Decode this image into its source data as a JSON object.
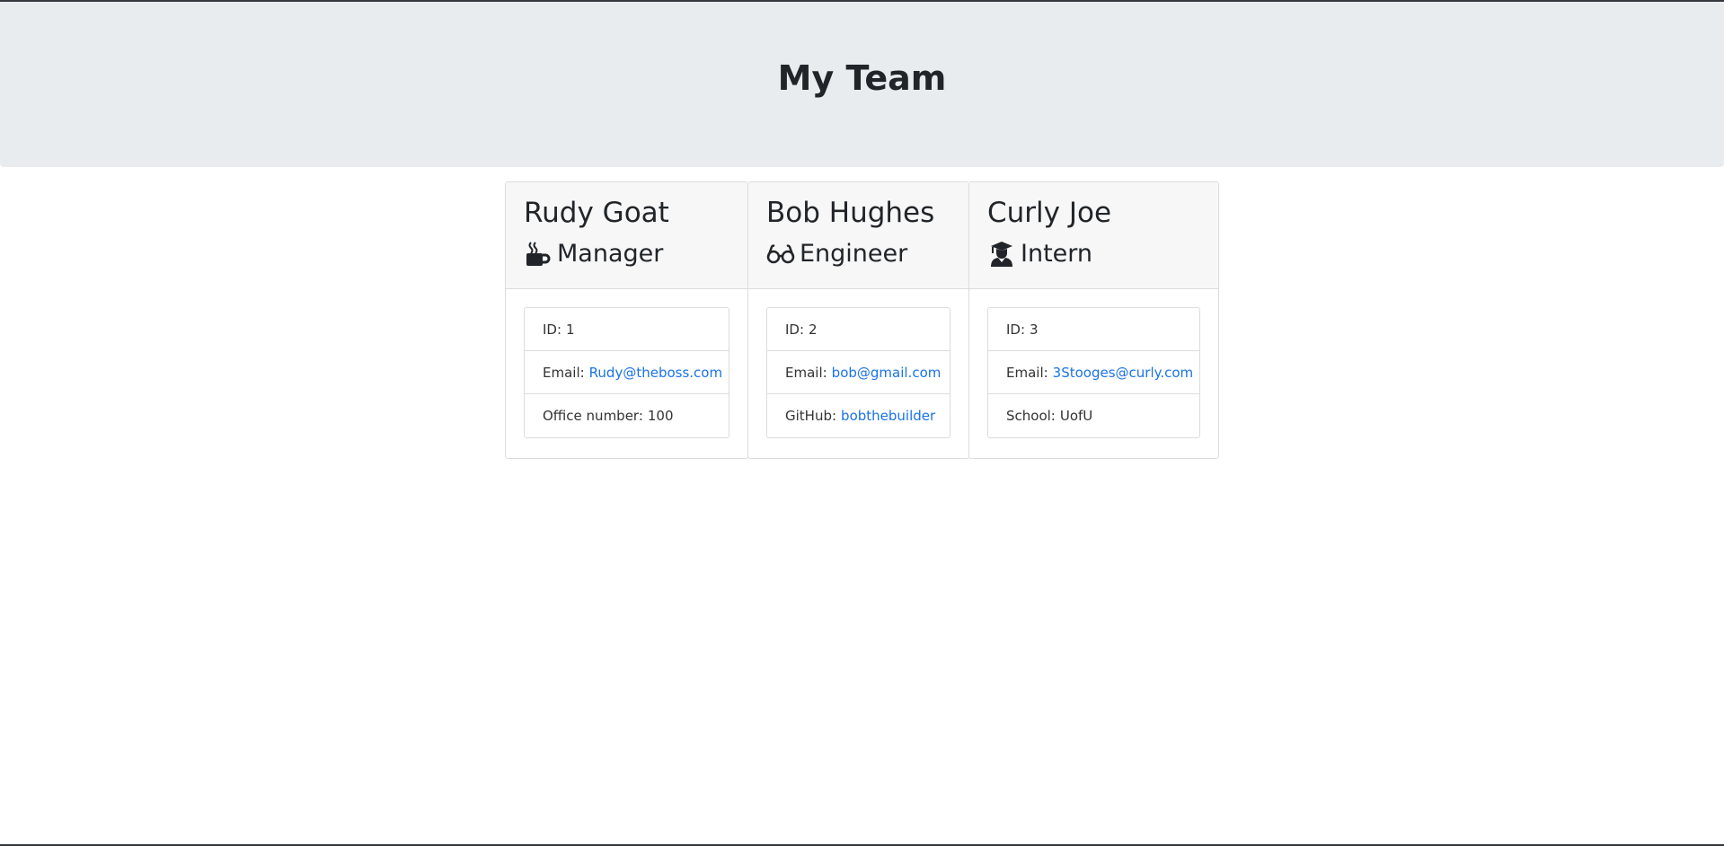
{
  "header": {
    "title": "My Team"
  },
  "colors": {
    "link": "#1a73e8",
    "jumbotron_bg": "#e9ecef",
    "card_header_bg": "#f7f7f7"
  },
  "team": [
    {
      "name": "Rudy Goat",
      "role": "Manager",
      "icon": "coffee-icon",
      "id_label": "ID:",
      "id_value": "1",
      "email_label": "Email:",
      "email": "Rudy@theboss.com",
      "extra_label": "Office number:",
      "extra_value": "100"
    },
    {
      "name": "Bob Hughes",
      "role": "Engineer",
      "icon": "glasses-icon",
      "id_label": "ID:",
      "id_value": "2",
      "email_label": "Email:",
      "email": "bob@gmail.com",
      "extra_label": "GitHub:",
      "extra_value": "bobthebuilder"
    },
    {
      "name": "Curly Joe",
      "role": "Intern",
      "icon": "graduate-icon",
      "id_label": "ID:",
      "id_value": "3",
      "email_label": "Email:",
      "email": "3Stooges@curly.com",
      "extra_label": "School:",
      "extra_value": "UofU"
    }
  ]
}
